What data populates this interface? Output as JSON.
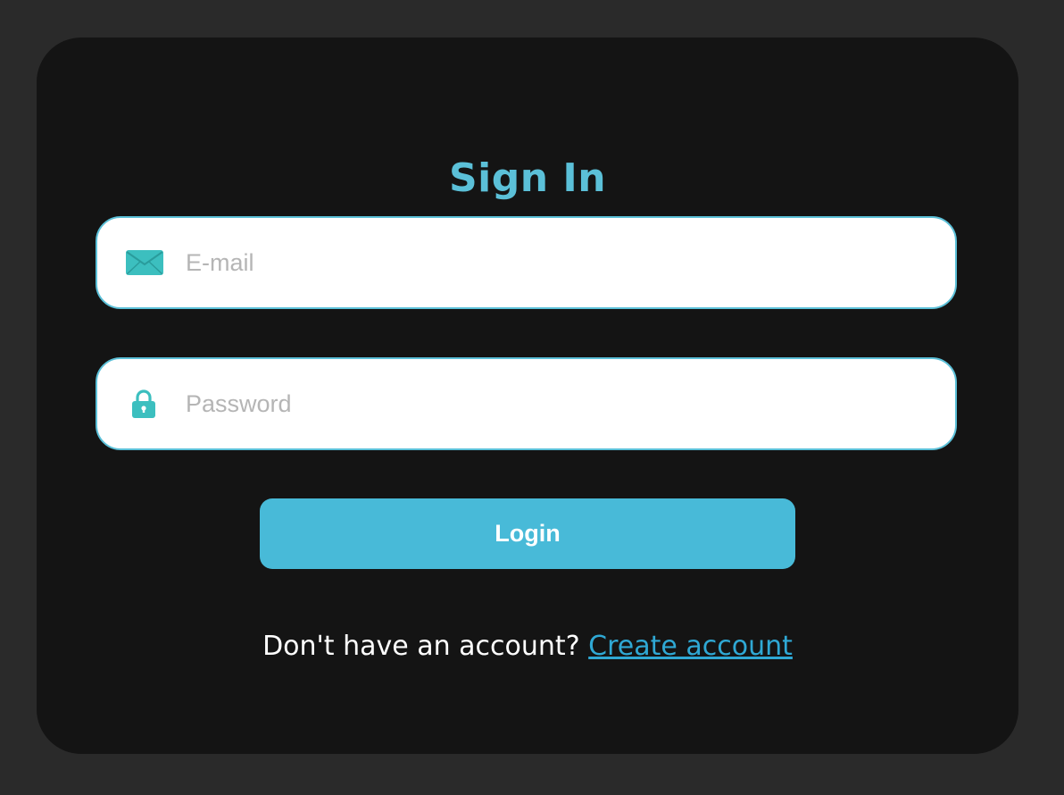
{
  "form": {
    "title": "Sign In",
    "email": {
      "placeholder": "E-mail",
      "value": "",
      "icon": "envelope-icon"
    },
    "password": {
      "placeholder": "Password",
      "value": "",
      "icon": "lock-icon"
    },
    "login_label": "Login",
    "footer_text": "Don't have an account? ",
    "create_account_label": "Create account"
  },
  "colors": {
    "page_bg": "#2a2a2a",
    "card_bg": "#141414",
    "accent": "#5bc0d8",
    "button_bg": "#48bad8",
    "link": "#2fa8d4",
    "icon": "#3cbfbf"
  }
}
